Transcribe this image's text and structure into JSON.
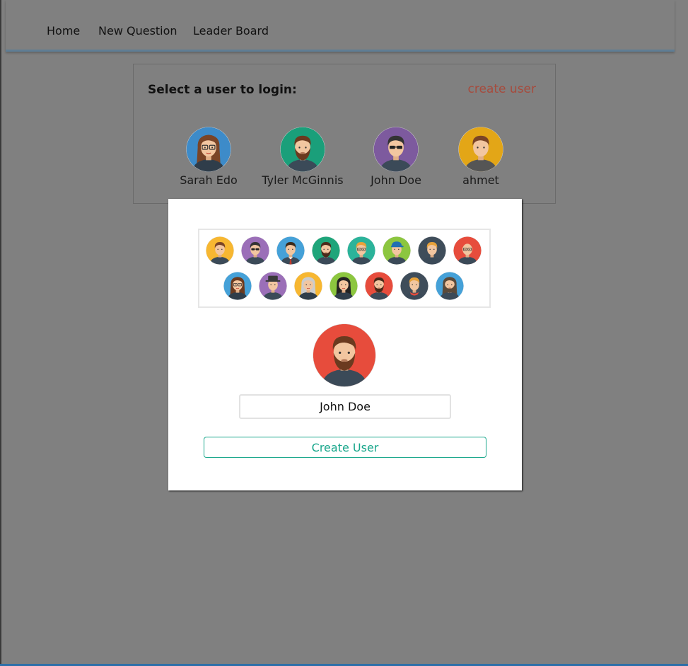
{
  "nav": {
    "items": [
      "Home",
      "New Question",
      "Leader Board"
    ]
  },
  "login": {
    "title": "Select a user to login:",
    "create_link": "create user",
    "users": [
      {
        "name": "Sarah Edo",
        "bg": "#3d8bc9",
        "hair": "#7a4426",
        "style": "woman-glasses"
      },
      {
        "name": "Tyler McGinnis",
        "bg": "#1a9f7a",
        "hair": "#6b3a1f",
        "style": "beard"
      },
      {
        "name": "John Doe",
        "bg": "#7d5a9e",
        "hair": "#333333",
        "style": "sunglasses"
      },
      {
        "name": "ahmet",
        "bg": "#e3a617",
        "hair": "#7a4426",
        "style": "hoodie"
      }
    ]
  },
  "modal": {
    "avatars": [
      {
        "bg": "#f7b731",
        "hair": "#7a4426",
        "style": "man"
      },
      {
        "bg": "#9b6fb8",
        "hair": "#333333",
        "style": "sunglasses"
      },
      {
        "bg": "#45a1d8",
        "hair": "#3a2a1a",
        "style": "man-tie"
      },
      {
        "bg": "#1fa57a",
        "hair": "#4a2a1a",
        "style": "beard"
      },
      {
        "bg": "#2bb39a",
        "hair": "#e8a23a",
        "style": "glasses"
      },
      {
        "bg": "#8cc63f",
        "hair": "#333333",
        "style": "cap"
      },
      {
        "bg": "#3f4d5a",
        "hair": "#e8a23a",
        "style": "man"
      },
      {
        "bg": "#e74c3c",
        "hair": "#e8c9a0",
        "style": "bald-glasses"
      },
      {
        "bg": "#45a1d8",
        "hair": "#6b3a1f",
        "style": "woman-glasses"
      },
      {
        "bg": "#9b6fb8",
        "hair": "#333333",
        "style": "hat"
      },
      {
        "bg": "#f7b731",
        "hair": "#cccccc",
        "style": "old-woman"
      },
      {
        "bg": "#8cc63f",
        "hair": "#222222",
        "style": "woman"
      },
      {
        "bg": "#e74c3c",
        "hair": "#4a2a1a",
        "style": "beard"
      },
      {
        "bg": "#3f4d5a",
        "hair": "#e8a23a",
        "style": "scarf"
      },
      {
        "bg": "#45a1d8",
        "hair": "#5a4a3a",
        "style": "long-hair-beard"
      }
    ],
    "selected_avatar": {
      "bg": "#e74c3c",
      "hair": "#6b3a1f",
      "style": "beard"
    },
    "name_value": "John Doe",
    "create_button": "Create User"
  }
}
